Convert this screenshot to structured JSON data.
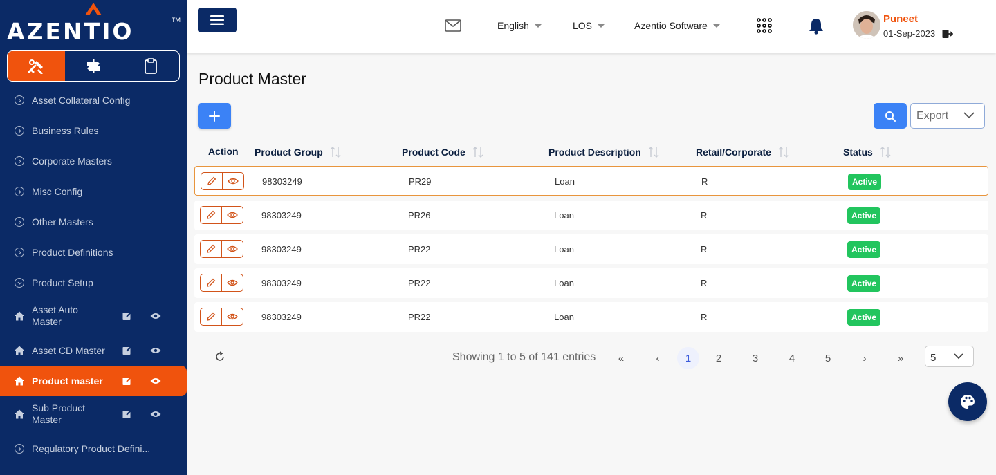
{
  "brand": {
    "logo_text": "AZENTIO",
    "trademark": "TM",
    "accent_color": "#f0530d",
    "primary_color": "#0b2a66"
  },
  "mode_tabs": [
    {
      "icon": "tools-icon",
      "active": true
    },
    {
      "icon": "signpost-icon",
      "active": false
    },
    {
      "icon": "clipboard-icon",
      "active": false
    }
  ],
  "sidebar": {
    "items": [
      {
        "label": "Asset Collateral Config",
        "icon": "chevron-right-circle-icon"
      },
      {
        "label": "Business Rules",
        "icon": "chevron-right-circle-icon"
      },
      {
        "label": "Corporate Masters",
        "icon": "chevron-right-circle-icon"
      },
      {
        "label": "Misc Config",
        "icon": "chevron-right-circle-icon"
      },
      {
        "label": "Other Masters",
        "icon": "chevron-right-circle-icon"
      },
      {
        "label": "Product Definitions",
        "icon": "chevron-right-circle-icon"
      },
      {
        "label": "Product Setup",
        "icon": "chevron-down-circle-icon"
      },
      {
        "label_line1": "Asset Auto",
        "label_line2": "Master",
        "icon": "home-icon"
      },
      {
        "label": "Asset CD Master",
        "icon": "home-icon"
      },
      {
        "label": "Product master",
        "icon": "home-icon",
        "active": true
      },
      {
        "label_line1": "Sub Product",
        "label_line2": "Master",
        "icon": "home-icon"
      },
      {
        "label": "Regulatory Product Defini...",
        "icon": "chevron-right-circle-icon"
      }
    ]
  },
  "header": {
    "language": "English",
    "module": "LOS",
    "company": "Azentio Software",
    "user": {
      "name": "Puneet",
      "date": "01-Sep-2023"
    }
  },
  "page": {
    "title": "Product Master"
  },
  "toolbar": {
    "export_placeholder": "Export"
  },
  "table": {
    "columns": [
      "Action",
      "Product Group",
      "Product Code",
      "Product Description",
      "Retail/Corporate",
      "Status"
    ],
    "rows": [
      {
        "group": "98303249",
        "code": "PR29",
        "description": "Loan",
        "type": "R",
        "status": "Active"
      },
      {
        "group": "98303249",
        "code": "PR26",
        "description": "Loan",
        "type": "R",
        "status": "Active"
      },
      {
        "group": "98303249",
        "code": "PR22",
        "description": "Loan",
        "type": "R",
        "status": "Active"
      },
      {
        "group": "98303249",
        "code": "PR22",
        "description": "Loan",
        "type": "R",
        "status": "Active"
      },
      {
        "group": "98303249",
        "code": "PR22",
        "description": "Loan",
        "type": "R",
        "status": "Active"
      }
    ]
  },
  "pagination": {
    "info": "Showing 1 to 5 of 141 entries",
    "first": "«",
    "prev": "‹",
    "pages": [
      "1",
      "2",
      "3",
      "4",
      "5"
    ],
    "next": "›",
    "last": "»",
    "page_size": "5"
  }
}
